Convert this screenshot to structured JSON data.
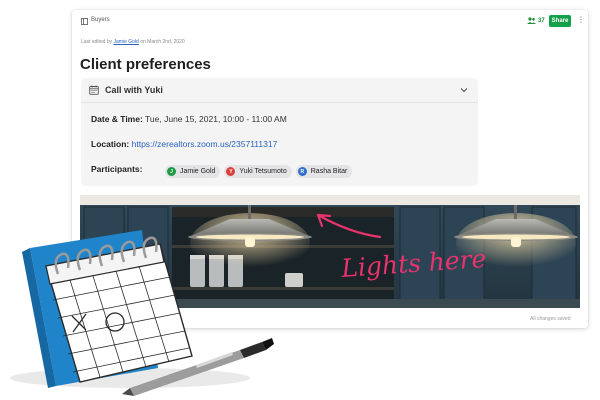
{
  "topbar": {
    "breadcrumb": "Buyers",
    "member_count": "37",
    "share_label": "Share",
    "more_icon": "⋮"
  },
  "last_edited": {
    "prefix": "Last edited by",
    "editor": "Jamie Gold",
    "suffix": "on March 2nd, 2020"
  },
  "page_title": "Client preferences",
  "meeting": {
    "title": "Call with Yuki",
    "date_label": "Date & Time:",
    "date_value": "Tue, June 15, 2021, 10:00 - 11:00 AM",
    "location_label": "Location:",
    "location_value": "https://zerealtors.zoom.us/2357111317",
    "participants_label": "Participants:",
    "participants": [
      {
        "initial": "J",
        "name": "Jamie Gold",
        "color": "#1e9a45"
      },
      {
        "initial": "Y",
        "name": "Yuki Tetsumoto",
        "color": "#d8423a"
      },
      {
        "initial": "R",
        "name": "Rasha Bitar",
        "color": "#2f6fcf"
      }
    ]
  },
  "photo": {
    "annotation": "Lights here",
    "annotation_color": "#e8336d"
  },
  "status": "All changes saved",
  "colors": {
    "accent_green": "#14a04b",
    "link_blue": "#2b63c5",
    "cabinet": "#2a3e4c"
  }
}
